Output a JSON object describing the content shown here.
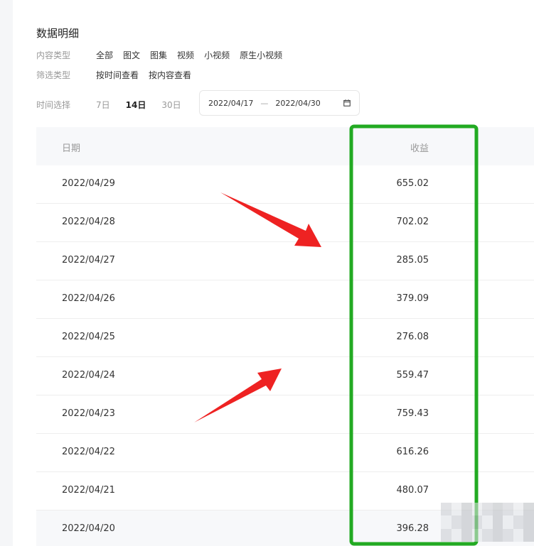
{
  "section": {
    "title": "数据明细"
  },
  "filters": {
    "content_type": {
      "label": "内容类型",
      "options": [
        "全部",
        "图文",
        "图集",
        "视频",
        "小视频",
        "原生小视频"
      ]
    },
    "filter_type": {
      "label": "筛选类型",
      "options": [
        "按时间查看",
        "按内容查看"
      ]
    },
    "time": {
      "label": "时间选择",
      "options": [
        "7日",
        "14日",
        "30日"
      ],
      "selected": "14日"
    },
    "date_range": {
      "start": "2022/04/17",
      "separator": "—",
      "end": "2022/04/30"
    }
  },
  "table": {
    "columns": {
      "date": "日期",
      "income": "收益"
    },
    "rows": [
      {
        "date": "2022/04/29",
        "income": "655.02"
      },
      {
        "date": "2022/04/28",
        "income": "702.02"
      },
      {
        "date": "2022/04/27",
        "income": "285.05"
      },
      {
        "date": "2022/04/26",
        "income": "379.09"
      },
      {
        "date": "2022/04/25",
        "income": "276.08"
      },
      {
        "date": "2022/04/24",
        "income": "559.47"
      },
      {
        "date": "2022/04/23",
        "income": "759.43"
      },
      {
        "date": "2022/04/22",
        "income": "616.26"
      },
      {
        "date": "2022/04/21",
        "income": "480.07"
      },
      {
        "date": "2022/04/20",
        "income": "396.28"
      }
    ]
  },
  "colors": {
    "highlight_box": "#22aa22",
    "arrow": "#ee2222",
    "active_text": "#222222",
    "muted_text": "#999999",
    "header_bg": "#f7f8fa"
  },
  "icons": {
    "date_picker": "calendar-icon"
  }
}
